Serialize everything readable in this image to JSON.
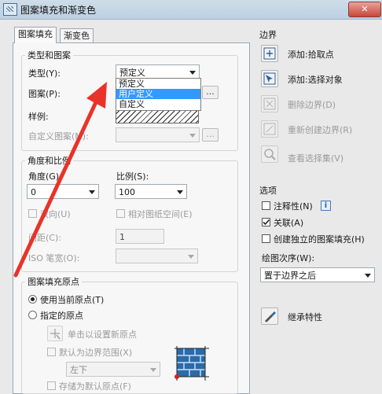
{
  "window": {
    "title": "图案填充和渐变色",
    "close_label": "✕"
  },
  "tabs": [
    {
      "label": "图案填充"
    },
    {
      "label": "渐变色"
    }
  ],
  "type_group": {
    "title": "类型和图案",
    "type_label": "类型(Y):",
    "type_value": "预定义",
    "type_options": [
      "预定义",
      "用户定义",
      "自定义"
    ],
    "pattern_label": "图案(P):",
    "swatch_label": "样例:",
    "custom_label": "自定义图案(M):",
    "browse_label": "..."
  },
  "angle_group": {
    "title": "角度和比例",
    "angle_label": "角度(G):",
    "angle_value": "0",
    "scale_label": "比例(S):",
    "scale_value": "100",
    "double_label": "双向(U)",
    "relative_label": "相对图纸空间(E)",
    "spacing_label": "间距(C):",
    "spacing_value": "1",
    "iso_label": "ISO 笔宽(O):"
  },
  "origin_group": {
    "title": "图案填充原点",
    "use_current_label": "使用当前原点(T)",
    "specified_label": "指定的原点",
    "click_set_label": "单击以设置新原点",
    "default_extents_label": "默认为边界范围(X)",
    "position_value": "左下",
    "store_default_label": "存储为默认原点(F)"
  },
  "boundaries": {
    "title": "边界",
    "pick_points": "添加:拾取点",
    "select_objects": "添加:选择对象",
    "remove": "删除边界(D)",
    "recreate": "重新创建边界(R)",
    "view_selections": "查看选择集(V)"
  },
  "options": {
    "title": "选项",
    "annotative": "注释性(N)",
    "info_icon": "i",
    "associative": "关联(A)",
    "separate": "创建独立的图案填充(H)",
    "draw_order_label": "绘图次序(W):",
    "draw_order_value": "置于边界之后"
  },
  "inherit": {
    "label": "继承特性"
  },
  "colors": {
    "arrow": "#e8332a",
    "selection": "#3399ff"
  }
}
